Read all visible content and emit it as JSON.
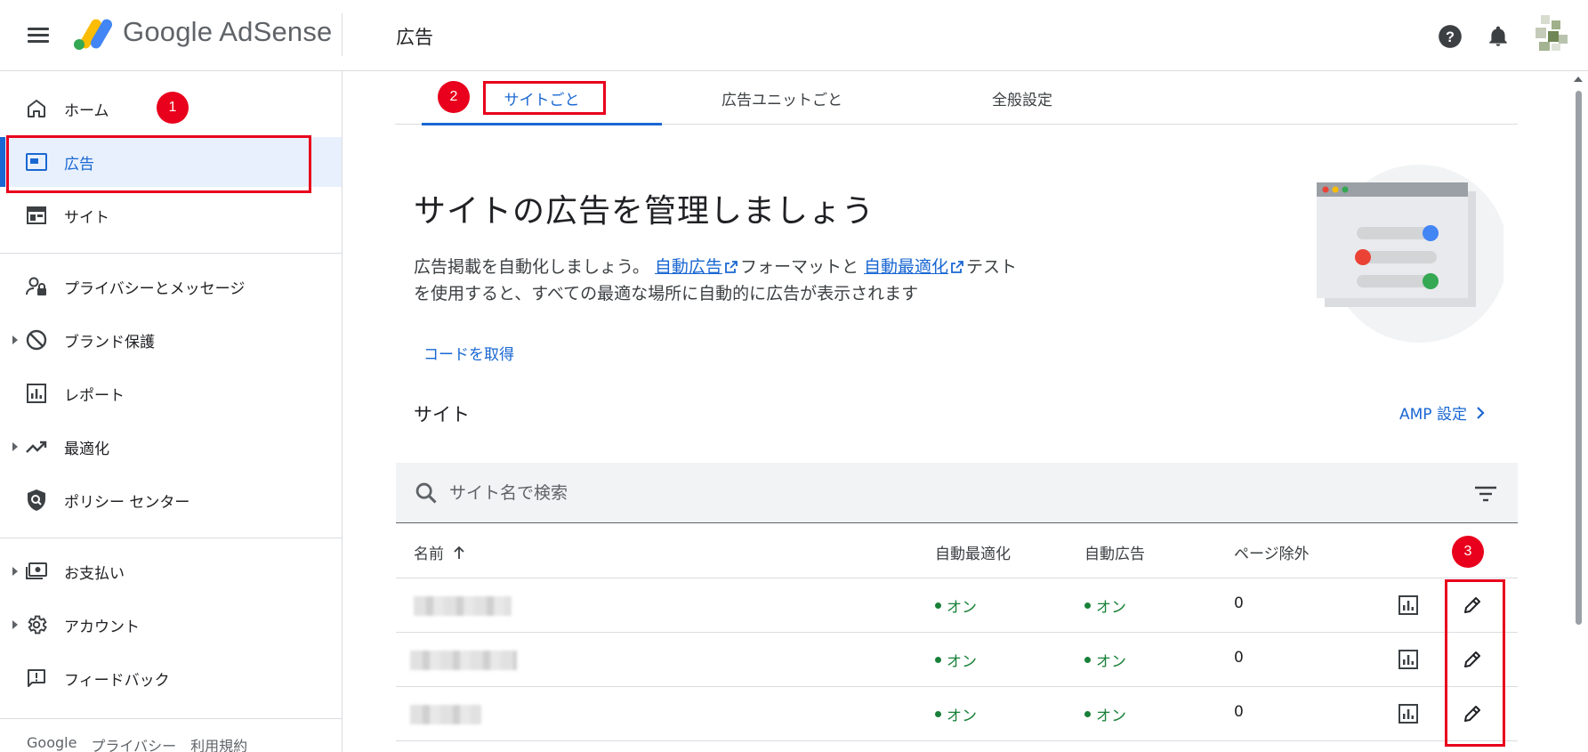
{
  "header": {
    "logo_text": "Google AdSense",
    "page_title": "広告"
  },
  "sidebar": {
    "items": [
      {
        "label": "ホーム",
        "icon": "home-icon"
      },
      {
        "label": "広告",
        "icon": "ads-icon",
        "active": true
      },
      {
        "label": "サイト",
        "icon": "sites-icon"
      },
      {
        "label": "プライバシーとメッセージ",
        "icon": "privacy-icon"
      },
      {
        "label": "ブランド保護",
        "icon": "block-icon"
      },
      {
        "label": "レポート",
        "icon": "report-icon"
      },
      {
        "label": "最適化",
        "icon": "trending-icon"
      },
      {
        "label": "ポリシー センター",
        "icon": "policy-shield-icon"
      },
      {
        "label": "お支払い",
        "icon": "payments-icon"
      },
      {
        "label": "アカウント",
        "icon": "gear-icon"
      },
      {
        "label": "フィードバック",
        "icon": "feedback-icon"
      }
    ],
    "footer": [
      "Google",
      "プライバシー",
      "利用規約"
    ]
  },
  "markers": [
    "1",
    "2",
    "3"
  ],
  "tabs": [
    {
      "label": "サイトごと",
      "active": true
    },
    {
      "label": "広告ユニットごと"
    },
    {
      "label": "全般設定"
    }
  ],
  "hero": {
    "title": "サイトの広告を管理しましょう",
    "desc_part1": "広告掲載を自動化しましょう。",
    "link1": "自動広告",
    "desc_part2": "フォーマットと",
    "link2": "自動最適化",
    "desc_part3": "テスト",
    "desc_line2": "を使用すると、すべての最適な場所に自動的に広告が表示されます",
    "get_code": "コードを取得"
  },
  "sites": {
    "heading": "サイト",
    "amp_link": "AMP 設定",
    "search_placeholder": "サイト名で検索",
    "columns": {
      "name": "名前",
      "auto_opt": "自動最適化",
      "auto_ads": "自動広告",
      "page_excl": "ページ除外"
    },
    "rows": [
      {
        "auto_opt": "オン",
        "auto_ads": "オン",
        "page_excl": "0"
      },
      {
        "auto_opt": "オン",
        "auto_ads": "オン",
        "page_excl": "0"
      },
      {
        "auto_opt": "オン",
        "auto_ads": "オン",
        "page_excl": "0"
      }
    ]
  },
  "colors": {
    "accent": "#1967d2",
    "on_status": "#188038",
    "annotation": "#e8001c"
  }
}
